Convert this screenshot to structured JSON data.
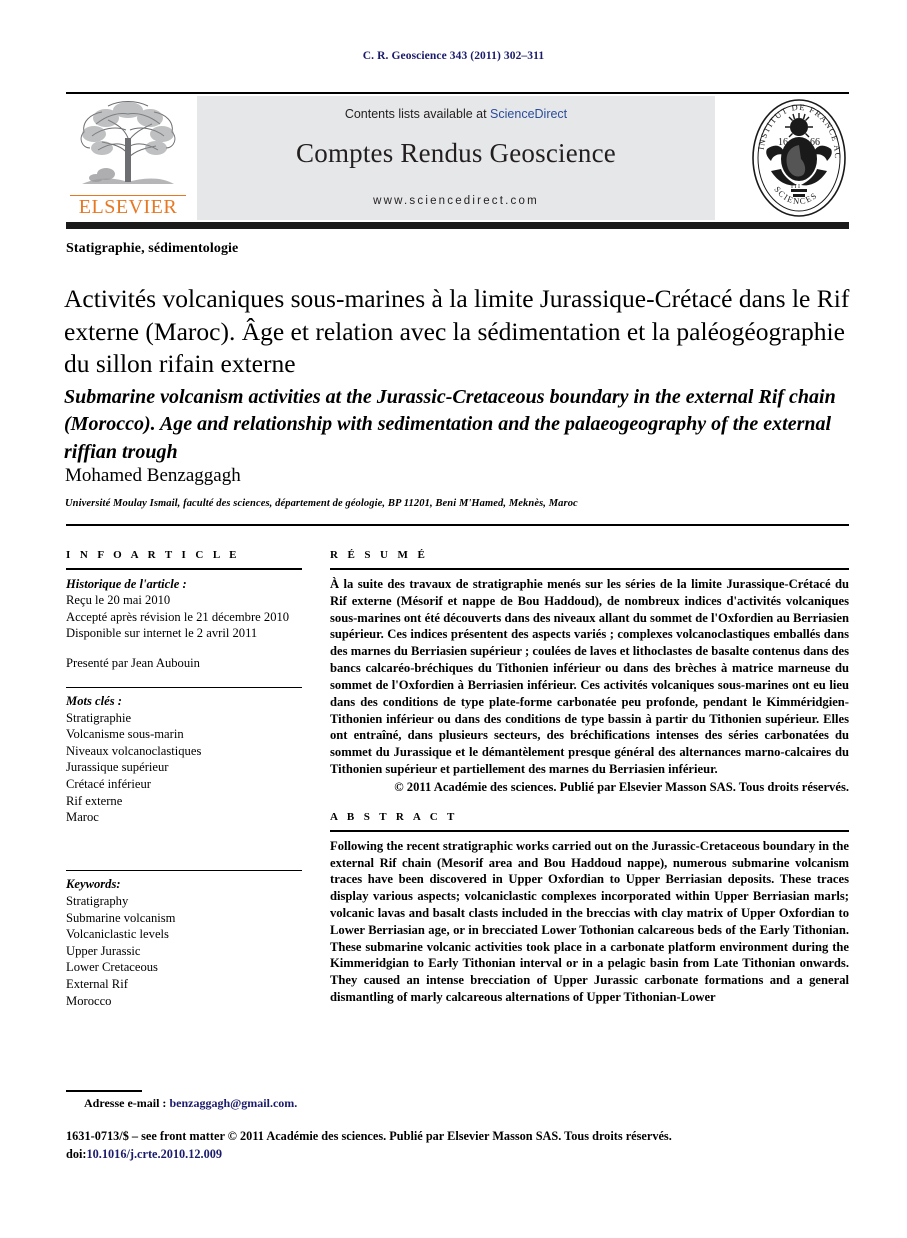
{
  "running_head": "C. R. Geoscience 343 (2011) 302–311",
  "masthead": {
    "contents_prefix": "Contents lists available at ",
    "sciencedirect": "ScienceDirect",
    "journal_name": "Comptes Rendus Geoscience",
    "url": "www.sciencedirect.com",
    "publisher_logo_text": "ELSEVIER",
    "seal": {
      "top_arc": "ACADEMIE DES",
      "left_arc": "INSTITUT DE FRANCE",
      "bottom_arc": "SCIENCES",
      "year_left": "16",
      "year_right": "66"
    },
    "colors": {
      "elsevier_orange": "#E87722",
      "sciencedirect_blue": "#2b4b9b",
      "band_grey": "#e6e7e8"
    }
  },
  "article": {
    "section_label": "Statigraphie, sédimentologie",
    "title_fr": "Activités volcaniques sous-marines à la limite Jurassique-Crétacé dans le Rif externe (Maroc). Âge et relation avec la sédimentation et la paléogéographie du sillon rifain externe",
    "title_en": "Submarine volcanism activities at the Jurassic-Cretaceous boundary in the external Rif chain (Morocco). Age and relationship with sedimentation and the palaeogeography of the external riffian trough",
    "author": "Mohamed Benzaggagh",
    "affiliation": "Université Moulay Ismail, faculté des sciences, département de géologie, BP 11201, Beni M'Hamed, Meknès, Maroc"
  },
  "info_article": {
    "heading": "I N F O   A R T I C L E",
    "history_label": "Historique de l'article :",
    "history": [
      "Reçu le 20 mai 2010",
      "Accepté après révision le 21 décembre 2010",
      "Disponible sur internet le 2 avril 2011"
    ],
    "presented_by": "Presenté par Jean Aubouin",
    "keywords_fr_label": "Mots clés :",
    "keywords_fr": [
      "Stratigraphie",
      "Volcanisme sous-marin",
      "Niveaux volcanoclastiques",
      "Jurassique supérieur",
      "Crétacé inférieur",
      "Rif externe",
      "Maroc"
    ],
    "keywords_en_label": "Keywords:",
    "keywords_en": [
      "Stratigraphy",
      "Submarine volcanism",
      "Volcaniclastic levels",
      "Upper Jurassic",
      "Lower Cretaceous",
      "External Rif",
      "Morocco"
    ]
  },
  "resume": {
    "heading": "R É S U M É",
    "text": "À la suite des travaux de stratigraphie menés sur les séries de la limite Jurassique-Crétacé du Rif externe (Mésorif et nappe de Bou Haddoud), de nombreux indices d'activités volcaniques sous-marines ont été découverts dans des niveaux allant du sommet de l'Oxfordien au Berriasien supérieur. Ces indices présentent des aspects variés ; complexes volcanoclastiques emballés dans des marnes du Berriasien supérieur ; coulées de laves et lithoclastes de basalte contenus dans des bancs calcaréo-bréchiques du Tithonien inférieur ou dans des brèches à matrice marneuse du sommet de l'Oxfordien à Berriasien inférieur. Ces activités volcaniques sous-marines ont eu lieu dans des conditions de type plate-forme carbonatée peu profonde, pendant le Kimméridgien-Tithonien inférieur ou dans des conditions de type bassin à partir du Tithonien supérieur. Elles ont entraîné, dans plusieurs secteurs, des bréchifications intenses des séries carbonatées du sommet du Jurassique et le démantèlement presque général des alternances marno-calcaires du Tithonien supérieur et partiellement des marnes du Berriasien inférieur.",
    "copyright": "© 2011 Académie des sciences. Publié par Elsevier Masson SAS. Tous droits réservés."
  },
  "abstract": {
    "heading": "A B S T R A C T",
    "text": "Following the recent stratigraphic works carried out on the Jurassic-Cretaceous boundary in the external Rif chain (Mesorif area and Bou Haddoud nappe), numerous submarine volcanism traces have been discovered in Upper Oxfordian to Upper Berriasian deposits. These traces display various aspects; volcaniclastic complexes incorporated within Upper Berriasian marls; volcanic lavas and basalt clasts included in the breccias with clay matrix of Upper Oxfordian to Lower Berriasian age, or in brecciated Lower Tothonian calcareous beds of the Early Tithonian. These submarine volcanic activities took place in a carbonate platform environment during the Kimmeridgian to Early Tithonian interval or in a pelagic basin from Late Tithonian onwards. They caused an intense brecciation of Upper Jurassic carbonate formations and a general dismantling of marly calcareous alternations of Upper Tithonian-Lower"
  },
  "footnote": {
    "email_label": "Adresse e-mail :",
    "email": "benzaggagh@gmail.com."
  },
  "footer": {
    "line1": "1631-0713/$ – see front matter © 2011 Académie des sciences. Publié par Elsevier Masson SAS. Tous droits réservés.",
    "doi_label": "doi:",
    "doi": "10.1016/j.crte.2010.12.009"
  }
}
